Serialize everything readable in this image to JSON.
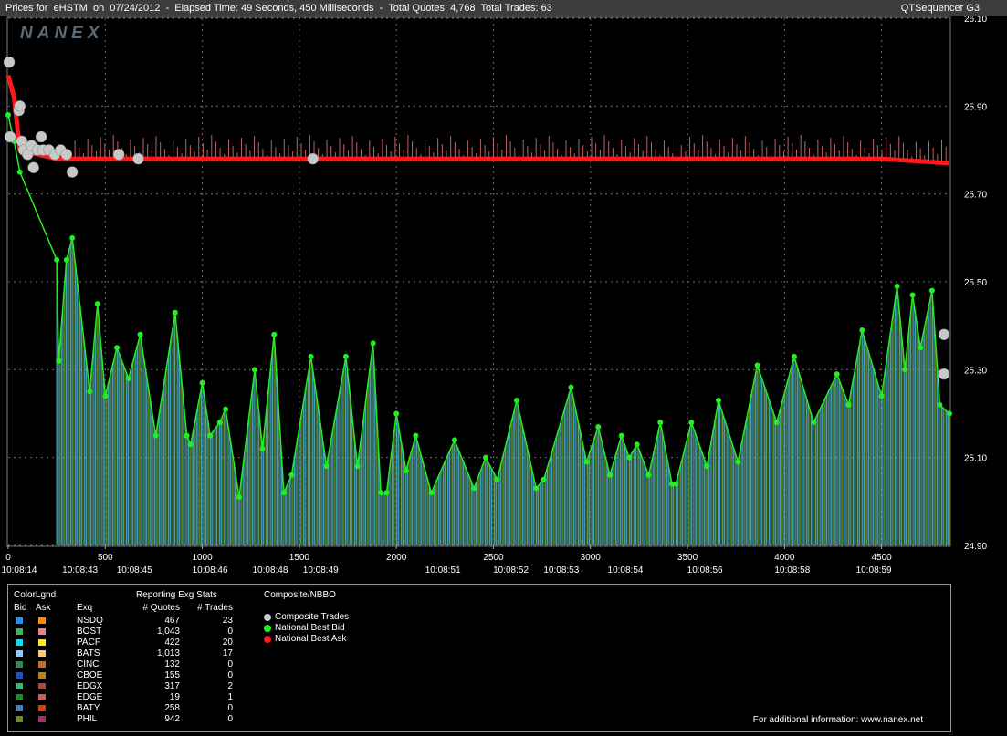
{
  "header": {
    "title": "Prices for  eHSTM  on  07/24/2012  -  Elapsed Time: 49 Seconds, 450 Milliseconds  -  Total Quotes: 4,768  Total Trades: 63",
    "app_name": "QTSequencer G3",
    "watermark": "NANEX"
  },
  "chart_data": {
    "type": "line",
    "y_ticks": [
      "26.10",
      "25.90",
      "25.70",
      "25.50",
      "25.30",
      "25.10",
      "24.90"
    ],
    "ylim": [
      24.9,
      26.1
    ],
    "x_seq_ticks": [
      "0",
      "500",
      "1000",
      "1500",
      "2000",
      "2500",
      "3000",
      "3500",
      "4000",
      "4500"
    ],
    "xlim": [
      0,
      4850
    ],
    "x_time_labels": [
      "10:08:14",
      "10:08:43",
      "10:08:45",
      "10:08:46",
      "10:08:48",
      "10:08:49",
      "10:08:51",
      "10:08:52",
      "10:08:53",
      "10:08:54",
      "10:08:56",
      "10:08:58",
      "10:08:59"
    ],
    "grid": true,
    "national_best_ask": {
      "x": [
        0,
        30,
        60,
        250,
        600,
        1200,
        2000,
        3000,
        4000,
        4500,
        4850
      ],
      "y": [
        25.97,
        25.92,
        25.8,
        25.78,
        25.78,
        25.78,
        25.78,
        25.78,
        25.78,
        25.78,
        25.77
      ]
    },
    "national_best_bid": {
      "x": [
        0,
        30,
        60,
        250,
        260,
        300,
        330,
        420,
        460,
        500,
        560,
        620,
        680,
        760,
        860,
        920,
        940,
        1000,
        1040,
        1090,
        1120,
        1190,
        1270,
        1310,
        1370,
        1420,
        1460,
        1560,
        1640,
        1740,
        1800,
        1880,
        1920,
        1950,
        2000,
        2050,
        2100,
        2180,
        2300,
        2400,
        2460,
        2520,
        2620,
        2720,
        2760,
        2900,
        2980,
        3040,
        3100,
        3160,
        3200,
        3240,
        3300,
        3360,
        3420,
        3440,
        3520,
        3600,
        3660,
        3760,
        3860,
        3960,
        4050,
        4150,
        4270,
        4330,
        4400,
        4500,
        4580,
        4620,
        4660,
        4700,
        4760,
        4800,
        4850
      ],
      "y": [
        25.88,
        25.82,
        25.75,
        25.55,
        25.32,
        25.55,
        25.6,
        25.25,
        25.45,
        25.24,
        25.35,
        25.28,
        25.38,
        25.15,
        25.43,
        25.15,
        25.13,
        25.27,
        25.15,
        25.18,
        25.21,
        25.01,
        25.3,
        25.12,
        25.38,
        25.02,
        25.06,
        25.33,
        25.08,
        25.33,
        25.08,
        25.36,
        25.02,
        25.02,
        25.2,
        25.07,
        25.15,
        25.02,
        25.14,
        25.03,
        25.1,
        25.05,
        25.23,
        25.03,
        25.05,
        25.26,
        25.09,
        25.17,
        25.06,
        25.15,
        25.1,
        25.13,
        25.06,
        25.18,
        25.04,
        25.04,
        25.18,
        25.08,
        25.23,
        25.09,
        25.31,
        25.18,
        25.33,
        25.18,
        25.29,
        25.22,
        25.39,
        25.24,
        25.49,
        25.3,
        25.47,
        25.35,
        25.48,
        25.22,
        25.2
      ]
    },
    "composite_trades": {
      "x": [
        5,
        10,
        55,
        60,
        70,
        80,
        100,
        120,
        130,
        150,
        170,
        180,
        210,
        240,
        270,
        300,
        330,
        570,
        670,
        1570,
        4850,
        4850
      ],
      "y": [
        26.0,
        25.83,
        25.89,
        25.9,
        25.82,
        25.8,
        25.79,
        25.81,
        25.76,
        25.8,
        25.83,
        25.8,
        25.8,
        25.79,
        25.8,
        25.79,
        25.75,
        25.79,
        25.78,
        25.78,
        25.38,
        25.29
      ]
    }
  },
  "legend": {
    "colorlegend_label": "ColorLgnd",
    "bid_header": "Bid",
    "ask_header": "Ask",
    "exch_header": "Exq",
    "stats_title": "Reporting Exg Stats",
    "quotes_header": "# Quotes",
    "trades_header": "# Trades",
    "composite_title": "Composite/NBBO",
    "rows": [
      {
        "exch": "NSDQ",
        "quotes": "467",
        "trades": "23",
        "bid_color": "#1e90ff",
        "ask_color": "#ff8c00"
      },
      {
        "exch": "BOST",
        "quotes": "1,043",
        "trades": "0",
        "bid_color": "#4caf50",
        "ask_color": "#f08080"
      },
      {
        "exch": "PACF",
        "quotes": "422",
        "trades": "20",
        "bid_color": "#00e5ff",
        "ask_color": "#ffee00"
      },
      {
        "exch": "BATS",
        "quotes": "1,013",
        "trades": "17",
        "bid_color": "#87cefa",
        "ask_color": "#ffc87a"
      },
      {
        "exch": "CINC",
        "quotes": "132",
        "trades": "0",
        "bid_color": "#2e8b57",
        "ask_color": "#d2691e"
      },
      {
        "exch": "CBOE",
        "quotes": "155",
        "trades": "0",
        "bid_color": "#1e50c8",
        "ask_color": "#b8860b"
      },
      {
        "exch": "EDGX",
        "quotes": "317",
        "trades": "2",
        "bid_color": "#3cb371",
        "ask_color": "#a0522d"
      },
      {
        "exch": "EDGE",
        "quotes": "19",
        "trades": "1",
        "bid_color": "#228b22",
        "ask_color": "#cd5c5c"
      },
      {
        "exch": "BATY",
        "quotes": "258",
        "trades": "0",
        "bid_color": "#4682b4",
        "ask_color": "#dc3c14"
      },
      {
        "exch": "PHIL",
        "quotes": "942",
        "trades": "0",
        "bid_color": "#6b8e23",
        "ask_color": "#a0306a"
      }
    ],
    "composite_items": [
      {
        "label": "Composite Trades",
        "color": "#c8c8c8"
      },
      {
        "label": "National Best Bid",
        "color": "#22ee22"
      },
      {
        "label": "National Best Ask",
        "color": "#ff1a1a"
      }
    ],
    "footer": "For additional information: www.nanex.net"
  },
  "colors": {
    "bid_line": "#22ee22",
    "ask_line": "#ff1a1a",
    "grid": "#c8c8c8",
    "trade": "#c8c8c8",
    "bid_fill": "#4fb8cf",
    "bid_fill2": "#6b8e23",
    "ask_fill": "#d07070"
  }
}
